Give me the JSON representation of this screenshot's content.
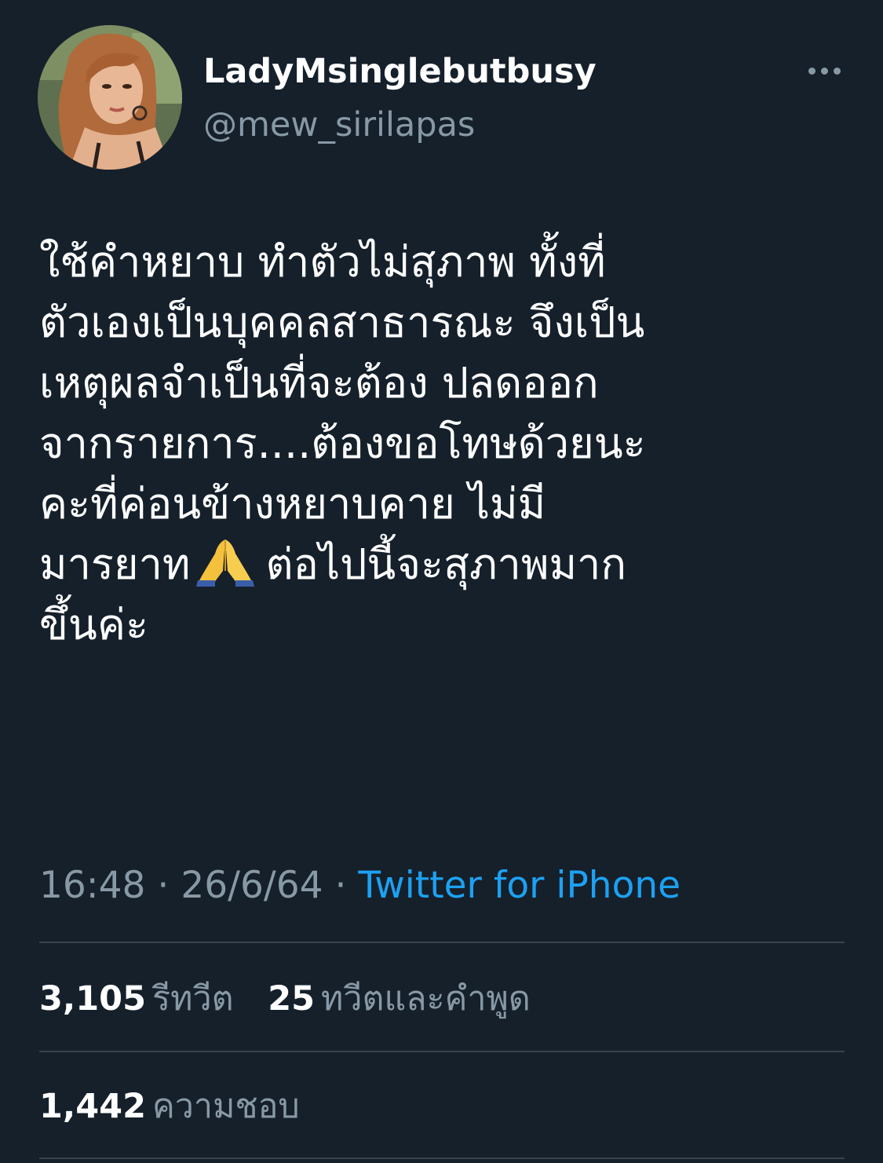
{
  "author": {
    "display_name": "LadyMsinglebutbusy",
    "handle": "@mew_sirilapas",
    "avatar_icon": "profile-photo"
  },
  "more_icon": "more-horizontal-icon",
  "tweet": {
    "lines": [
      " ใช้คำหยาบ ทำตัวไม่สุภาพ ทั้งที่",
      "ตัวเองเป็นบุคคลสาธารณะ จึงเป็น",
      "เหตุผลจำเป็นที่จะต้อง ปลดออก",
      "จากรายการ....ต้องขอโทษด้วยนะ",
      "คะที่ค่อนข้างหยาบคาย ไม่มี",
      "มารยาท",
      "ต่อไปนี้จะสุภาพมาก",
      "ขึ้นค่ะ"
    ],
    "emoji": "folded-hands-emoji"
  },
  "meta": {
    "time": "16:48",
    "separator": "·",
    "date": "26/6/64",
    "source": "Twitter for iPhone"
  },
  "stats": {
    "retweets_count": "3,105",
    "retweets_label": "รีทวีต",
    "quotes_count": "25",
    "quotes_label": "ทวีตและคำพูด",
    "likes_count": "1,442",
    "likes_label": "ความชอบ"
  },
  "colors": {
    "background": "#15202b",
    "text_primary": "#ffffff",
    "text_secondary": "#8899a6",
    "link": "#1da1f2",
    "divider": "#38444d"
  }
}
